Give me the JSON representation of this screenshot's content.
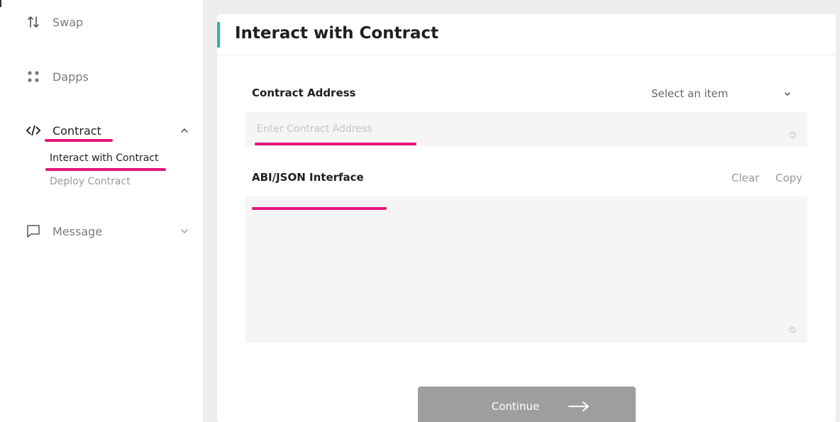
{
  "sidebar": {
    "items": [
      {
        "label": "Swap",
        "icon": "swap-icon"
      },
      {
        "label": "Dapps",
        "icon": "dapps-icon"
      },
      {
        "label": "Contract",
        "icon": "code-icon",
        "expanded": true,
        "children": [
          {
            "label": "Interact with Contract",
            "active": true
          },
          {
            "label": "Deploy Contract",
            "active": false
          }
        ]
      },
      {
        "label": "Message",
        "icon": "message-icon",
        "expanded": false
      }
    ]
  },
  "panel": {
    "title": "Interact with Contract",
    "contract_address": {
      "label": "Contract Address",
      "select_placeholder": "Select an item",
      "input_placeholder": "Enter Contract Address",
      "input_value": ""
    },
    "abi": {
      "label": "ABI/JSON Interface",
      "clear_label": "Clear",
      "copy_label": "Copy",
      "value": ""
    },
    "continue_label": "Continue"
  },
  "colors": {
    "accent": "#21b6a8",
    "highlight": "#e5157c",
    "button_disabled": "#9e9e9e",
    "canvas": "#eeeeee"
  }
}
